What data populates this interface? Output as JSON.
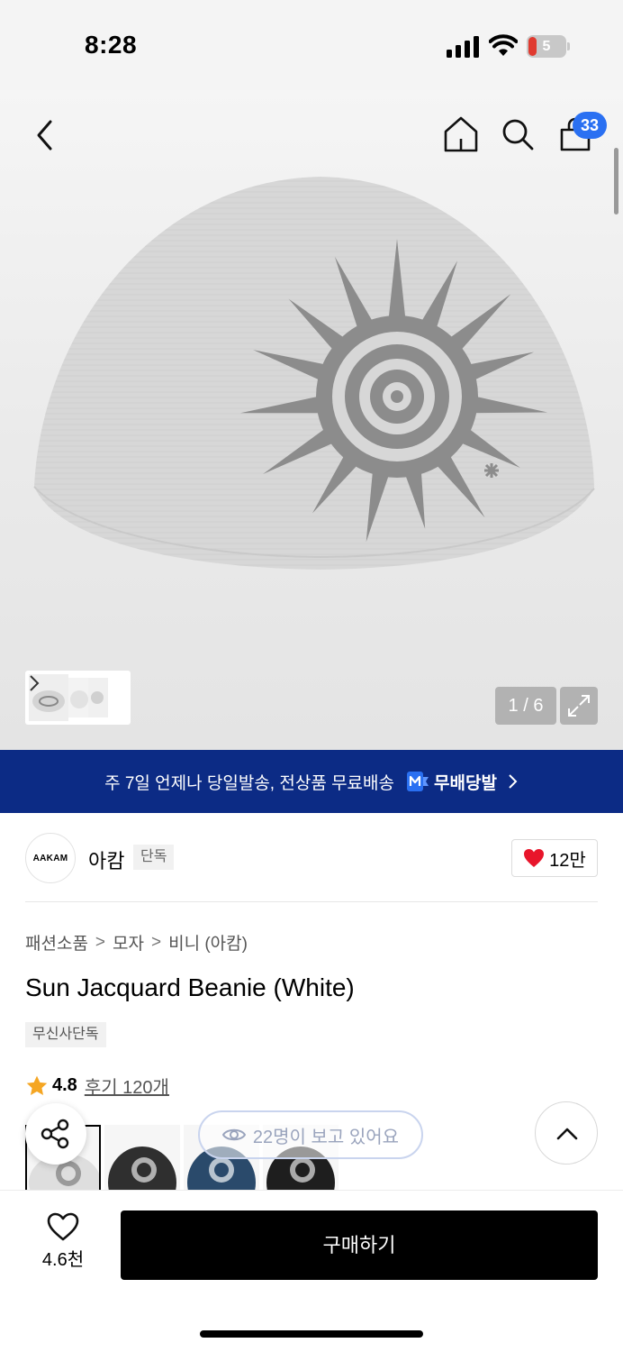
{
  "status_bar": {
    "time": "8:28",
    "battery_level": "5",
    "icons": [
      "cellular-signal-icon",
      "wifi-icon",
      "battery-icon"
    ]
  },
  "nav": {
    "icons": [
      "back-icon",
      "home-icon",
      "search-icon",
      "cart-icon"
    ],
    "cart_count": "33"
  },
  "gallery": {
    "counter": "1 / 6",
    "thumb_more_icon": "chevron-right-icon",
    "expand_icon": "expand-icon"
  },
  "promo": {
    "text": "주 7일 언제나 당일발송, 전상품 무료배송",
    "brand": "무배당발",
    "colors": {
      "background": "#0c2b85",
      "logo": "#2a70f2"
    }
  },
  "brand": {
    "logo_text": "AAKAM",
    "name": "아캄",
    "tag": "단독",
    "likes": "12만"
  },
  "breadcrumb": [
    "패션소품",
    "모자",
    "비니 (아캄)"
  ],
  "product": {
    "title": "Sun Jacquard Beanie (White)",
    "badge": "무신사단독",
    "rating": "4.8",
    "reviews": "후기 120개"
  },
  "variants": [
    {
      "color": "white"
    },
    {
      "color": "black"
    },
    {
      "color": "navy"
    },
    {
      "color": "black"
    }
  ],
  "floating": {
    "viewing": "22명이 보고 있어요",
    "share_icon": "share-icon",
    "scroll_top_icon": "chevron-up-icon"
  },
  "bottom_bar": {
    "wish_count": "4.6천",
    "buy_label": "구매하기"
  }
}
